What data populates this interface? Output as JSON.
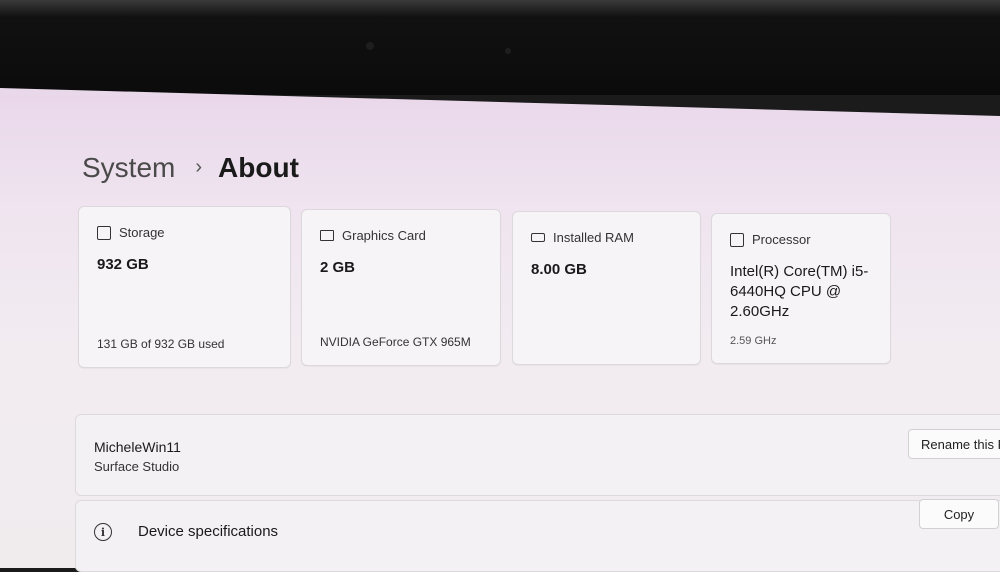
{
  "breadcrumb": {
    "parent": "System",
    "separator": "›",
    "current": "About"
  },
  "cards": [
    {
      "icon": "storage-icon",
      "label": "Storage",
      "value": "932 GB",
      "sub": "131 GB of 932 GB used"
    },
    {
      "icon": "graphics-card-icon",
      "label": "Graphics Card",
      "value": "2 GB",
      "sub": "NVIDIA GeForce GTX 965M"
    },
    {
      "icon": "ram-icon",
      "label": "Installed RAM",
      "value": "8.00 GB",
      "sub": ""
    },
    {
      "icon": "processor-icon",
      "label": "Processor",
      "value": "Intel(R) Core(TM) i5-6440HQ CPU @ 2.60GHz",
      "sub": "2.59 GHz"
    }
  ],
  "device": {
    "name": "MicheleWin11",
    "model": "Surface Studio",
    "rename_label": "Rename this PC"
  },
  "specs": {
    "icon": "info-icon",
    "label": "Device specifications",
    "copy_label": "Copy"
  }
}
